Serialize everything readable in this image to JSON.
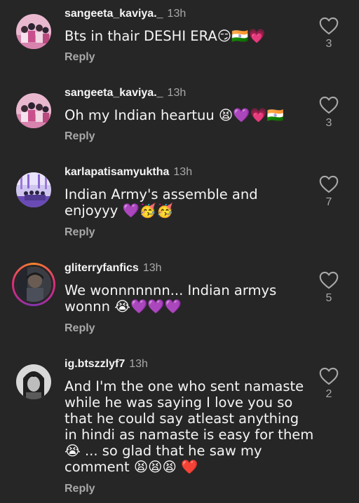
{
  "comments": [
    {
      "username": "sangeeta_kaviya._",
      "time": "13h",
      "text": "Bts in thair DESHI ERA😏🇮🇳💗",
      "reply": "Reply",
      "likes": "3",
      "avatar": "bts-group-photo"
    },
    {
      "username": "sangeeta_kaviya._",
      "time": "13h",
      "text": "Oh my Indian heartuu 😫💜💗🇮🇳",
      "reply": "Reply",
      "likes": "3",
      "avatar": "bts-group-photo"
    },
    {
      "username": "karlapatisamyuktha",
      "time": "13h",
      "text": "Indian Army's assemble and enjoyyy 💜🥳🥳",
      "reply": "Reply",
      "likes": "7",
      "avatar": "concert-stage-photo"
    },
    {
      "username": "gliterryfanfics",
      "time": "13h",
      "text": "We wonnnnnnn... Indian armys wonnn 😭💜💜💜",
      "reply": "Reply",
      "likes": "5",
      "avatar": "portrait-with-story-ring"
    },
    {
      "username": "ig.btszzlyf7",
      "time": "13h",
      "text": "And I'm the one who sent namaste while he was saying I love you so that he could say atleast anything in hindi as namaste is easy for them 😭 ... so glad that he saw my comment 😫😫😫 ❤️",
      "reply": "Reply",
      "likes": "2",
      "avatar": "black-and-white-portrait"
    }
  ],
  "colors": {
    "background": "#262626",
    "text": "#f5f5f5",
    "muted": "#a8a8a8"
  },
  "icons": {
    "like": "heart-outline-icon"
  }
}
